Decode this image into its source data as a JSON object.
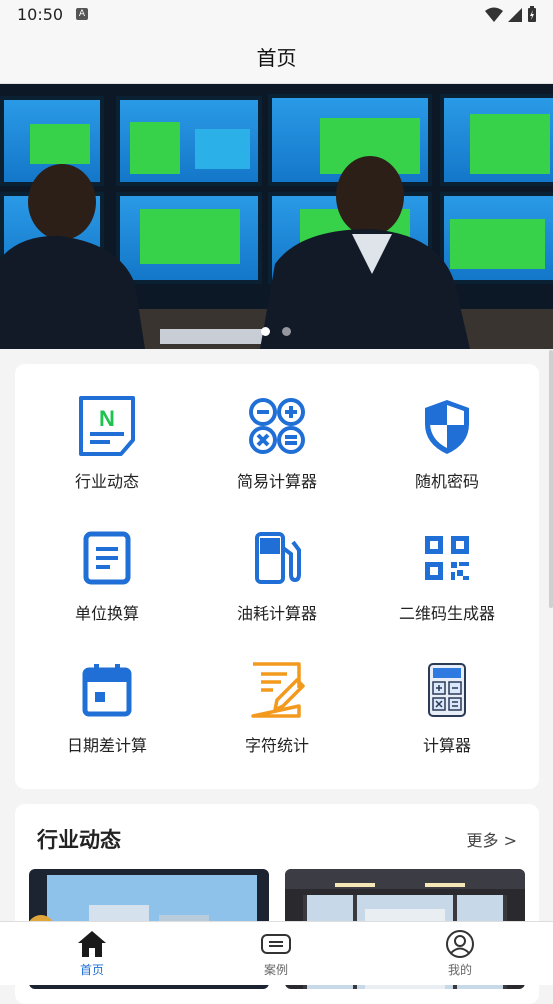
{
  "status": {
    "time": "10:50",
    "badge": "A"
  },
  "header": {
    "title": "首页"
  },
  "banner": {
    "slide_count": 2,
    "active_slide": 1
  },
  "tools": [
    {
      "label": "行业动态",
      "icon": "news-icon"
    },
    {
      "label": "简易计算器",
      "icon": "calculator-ops-icon"
    },
    {
      "label": "随机密码",
      "icon": "shield-icon"
    },
    {
      "label": "单位换算",
      "icon": "document-icon"
    },
    {
      "label": "油耗计算器",
      "icon": "fuel-icon"
    },
    {
      "label": "二维码生成器",
      "icon": "qr-code-icon"
    },
    {
      "label": "日期差计算",
      "icon": "calendar-icon"
    },
    {
      "label": "字符统计",
      "icon": "edit-note-icon"
    },
    {
      "label": "计算器",
      "icon": "calculator-icon"
    }
  ],
  "news": {
    "title": "行业动态",
    "more": "更多 >"
  },
  "tabs": [
    {
      "label": "首页",
      "icon": "home-icon",
      "active": true
    },
    {
      "label": "案例",
      "icon": "cases-icon",
      "active": false
    },
    {
      "label": "我的",
      "icon": "profile-icon",
      "active": false
    }
  ],
  "colors": {
    "accent": "#1f6fd6",
    "orange": "#f39a1e",
    "green": "#1ec24f"
  }
}
